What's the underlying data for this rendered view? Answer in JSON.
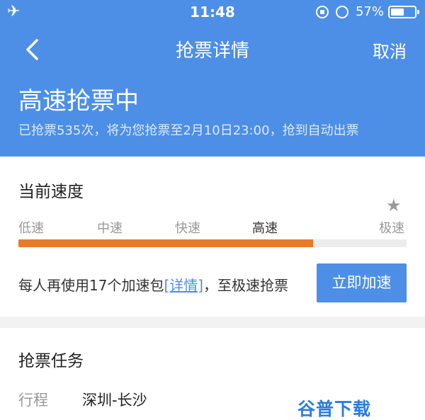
{
  "status_bar": {
    "time": "11:48",
    "battery": "57%",
    "battery_level": 0.57,
    "airplane": "airplane-icon"
  },
  "nav": {
    "title": "抢票详情",
    "cancel_label": "取消"
  },
  "header": {
    "headline": "高速抢票中",
    "subtext": "已抢票535次，将为您抢票至2月10日23:00，抢到自动出票"
  },
  "speed": {
    "title": "当前速度",
    "levels": [
      "低速",
      "中速",
      "快速",
      "高速",
      "极速"
    ],
    "current_level": "高速",
    "progress": 0.76,
    "promo_prefix": "每人再使用17个加速包",
    "promo_link": "[详情]",
    "promo_suffix": "，至极速抢票",
    "boost_label": "立即加速"
  },
  "task": {
    "title": "抢票任务",
    "route_label": "行程",
    "route_value": "深圳-长沙"
  },
  "watermark": "谷普下载",
  "colors": {
    "primary": "#4d8fe6",
    "progress": "#ed7a22"
  }
}
